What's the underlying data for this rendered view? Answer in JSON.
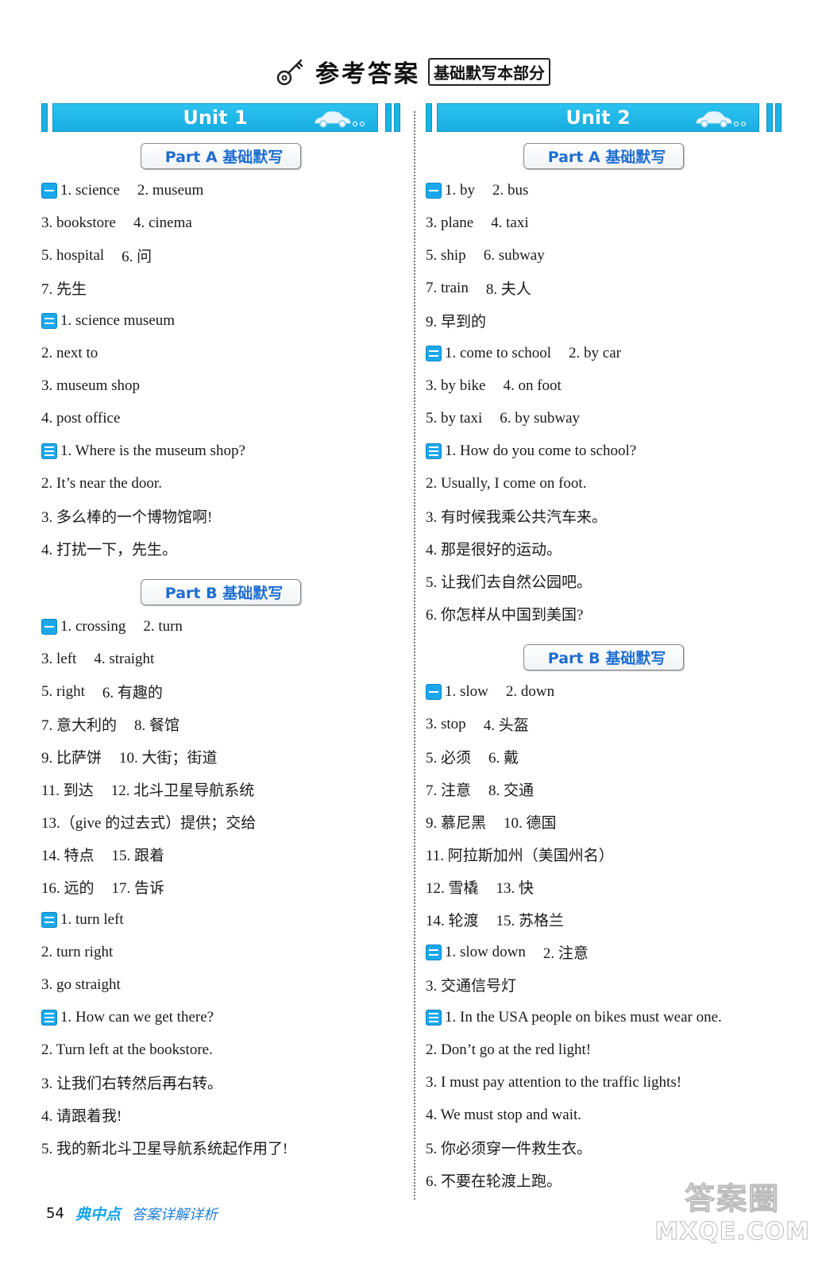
{
  "header": {
    "title": "参考答案",
    "subtitle": "基础默写本部分",
    "icon": "key-icon"
  },
  "units": [
    {
      "title": "Unit 1",
      "parts": [
        {
          "label": "Part A 基础默写",
          "sections": [
            {
              "icon": "section-one-icon",
              "lines": [
                [
                  "1. science",
                  "2. museum"
                ],
                [
                  "3. bookstore",
                  "4. cinema"
                ],
                [
                  "5. hospital",
                  "6. 问"
                ],
                [
                  "7. 先生"
                ]
              ]
            },
            {
              "icon": "section-two-icon",
              "lines": [
                [
                  "1. science museum"
                ],
                [
                  "2. next to"
                ],
                [
                  "3. museum shop"
                ],
                [
                  "4. post office"
                ]
              ]
            },
            {
              "icon": "section-three-icon",
              "lines": [
                [
                  "1. Where is the museum shop?"
                ],
                [
                  "2. It’s near the door."
                ],
                [
                  "3. 多么棒的一个博物馆啊!"
                ],
                [
                  "4. 打扰一下，先生。"
                ]
              ]
            }
          ]
        },
        {
          "label": "Part B 基础默写",
          "sections": [
            {
              "icon": "section-one-icon",
              "lines": [
                [
                  "1. crossing",
                  "2. turn"
                ],
                [
                  "3. left",
                  "4. straight"
                ],
                [
                  "5. right",
                  "6. 有趣的"
                ],
                [
                  "7. 意大利的",
                  "8. 餐馆"
                ],
                [
                  "9. 比萨饼",
                  "10. 大街；街道"
                ],
                [
                  "11. 到达",
                  "12. 北斗卫星导航系统"
                ],
                [
                  "13.（give 的过去式）提供；交给"
                ],
                [
                  "14. 特点",
                  "15. 跟着"
                ],
                [
                  "16. 远的",
                  "17. 告诉"
                ]
              ]
            },
            {
              "icon": "section-two-icon",
              "lines": [
                [
                  "1. turn left"
                ],
                [
                  "2. turn right"
                ],
                [
                  "3. go straight"
                ]
              ]
            },
            {
              "icon": "section-three-icon",
              "lines": [
                [
                  "1. How can we get there?"
                ],
                [
                  "2. Turn left at the bookstore."
                ],
                [
                  "3. 让我们右转然后再右转。"
                ],
                [
                  "4. 请跟着我!"
                ],
                [
                  "5. 我的新北斗卫星导航系统起作用了!"
                ]
              ]
            }
          ]
        }
      ]
    },
    {
      "title": "Unit 2",
      "parts": [
        {
          "label": "Part A 基础默写",
          "sections": [
            {
              "icon": "section-one-icon",
              "lines": [
                [
                  "1. by",
                  "2. bus"
                ],
                [
                  "3. plane",
                  "4. taxi"
                ],
                [
                  "5. ship",
                  "6. subway"
                ],
                [
                  "7. train",
                  "8. 夫人"
                ],
                [
                  "9. 早到的"
                ]
              ]
            },
            {
              "icon": "section-two-icon",
              "lines": [
                [
                  "1. come to school",
                  "2. by car"
                ],
                [
                  "3. by bike",
                  "4. on foot"
                ],
                [
                  "5. by taxi",
                  "6. by subway"
                ]
              ]
            },
            {
              "icon": "section-three-icon",
              "lines": [
                [
                  "1. How do you come to school?"
                ],
                [
                  "2. Usually, I come on foot."
                ],
                [
                  "3. 有时候我乘公共汽车来。"
                ],
                [
                  "4. 那是很好的运动。"
                ],
                [
                  "5. 让我们去自然公园吧。"
                ],
                [
                  "6. 你怎样从中国到美国?"
                ]
              ]
            }
          ]
        },
        {
          "label": "Part B 基础默写",
          "sections": [
            {
              "icon": "section-one-icon",
              "lines": [
                [
                  "1. slow",
                  "2. down"
                ],
                [
                  "3. stop",
                  "4. 头盔"
                ],
                [
                  "5. 必须",
                  "6. 戴"
                ],
                [
                  "7. 注意",
                  "8. 交通"
                ],
                [
                  "9. 慕尼黑",
                  "10. 德国"
                ],
                [
                  "11. 阿拉斯加州（美国州名）"
                ],
                [
                  "12. 雪橇",
                  "13. 快"
                ],
                [
                  "14. 轮渡",
                  "15. 苏格兰"
                ]
              ]
            },
            {
              "icon": "section-two-icon",
              "lines": [
                [
                  "1. slow down",
                  "2. 注意"
                ],
                [
                  "3. 交通信号灯"
                ]
              ]
            },
            {
              "icon": "section-three-icon",
              "lines": [
                [
                  "1. In the USA people on bikes must wear one."
                ],
                [
                  "2. Don’t go at the red light!"
                ],
                [
                  "3. I must pay attention to the traffic lights!"
                ],
                [
                  "4. We must stop and wait."
                ],
                [
                  "5. 你必须穿一件救生衣。"
                ],
                [
                  "6. 不要在轮渡上跑。"
                ]
              ]
            }
          ]
        }
      ]
    }
  ],
  "footer": {
    "page_number": "54",
    "brand": "典中点",
    "brand_sub": "答案详解详析"
  },
  "watermark": {
    "line1": "答案圈",
    "line2": "MXQE.COM"
  },
  "colors": {
    "accent_blue": "#19b4e8",
    "part_label_blue": "#1f6fd0"
  }
}
